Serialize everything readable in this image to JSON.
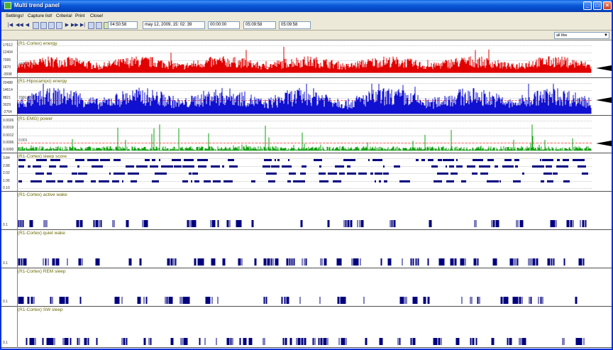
{
  "window": {
    "title": "Multi trend panel",
    "controls": [
      "_",
      "□",
      "×"
    ]
  },
  "menu": [
    "Settings!",
    "Capture list!",
    "Criteria!",
    "Print",
    "Close!"
  ],
  "toolbar": {
    "nav_buttons": [
      "|◀",
      "◀◀",
      "◀",
      "▶",
      "▶▶",
      "▶|"
    ],
    "start_time": "04:50:58",
    "datetime": "may 12, 2009, 15: 02: 39",
    "offset": "00:00:00",
    "end_time": "05:09:58",
    "duration": "05:09:58"
  },
  "channel_select": "all libs",
  "colors": {
    "energy_cortex": "#e00000",
    "energy_hipocampo": "#1010d0",
    "emg": "#10a010",
    "states": "#00007f"
  },
  "panels": [
    {
      "title": "(R1-Cortex)  energy",
      "yticks": [
        "17612",
        "12404",
        "7095",
        "1870",
        "-3598"
      ],
      "threshold_label": "4000.000"
    },
    {
      "title": "(R1-Hipocampo)  energy",
      "yticks": [
        "20488",
        "14614",
        "8821",
        "3029",
        "-2764"
      ],
      "threshold_label": "7000.000"
    },
    {
      "title": "(R1-EMG)  power",
      "yticks": [
        "0.0026",
        "0.0019",
        "0.0012",
        "0.0006",
        "0.0000"
      ],
      "threshold_label": "0.001"
    },
    {
      "title": "(R1-Cortex)  sleep score",
      "yticks": [
        "3.84",
        "2.88",
        "2.02",
        "1.06",
        "0.10"
      ]
    },
    {
      "title": "(R1-Cortex)  active wake",
      "yticks": [
        "0.1"
      ]
    },
    {
      "title": "(R1-Cortex)  quiet wake",
      "yticks": [
        "0.1"
      ]
    },
    {
      "title": "(R1-Cortex)  REM sleep",
      "yticks": [
        "0.1"
      ]
    },
    {
      "title": "(R1-Cortex)  SW sleep",
      "yticks": [
        "0.1"
      ]
    }
  ]
}
